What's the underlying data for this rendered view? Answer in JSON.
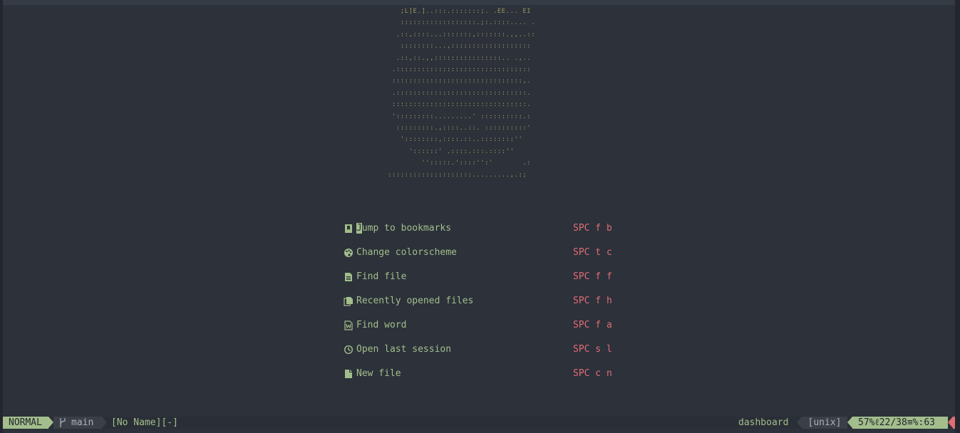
{
  "header_art": [
    "   ;L]E.]..:::.:::::::;. .EE... EI",
    "   ::::::::::::::::::.;:.::::.... .",
    "  .::,::::...:::::::,:::::::.,,..::",
    "   ::::::::...,:::::::::::::::::::",
    "  .::,::.,,::::::::::::::::.. .,..",
    " .::::::::::::::::::::::::::::::::",
    " :::::::::::::::::::::::::::::::,.",
    " .:::::::::::::::::::::::::::::::.",
    " ::::::::::::::::::::::::::::::::.",
    " ':::::::::.........' ::::::::::.:",
    "  :::::::::.,::::..::. ::::::::::'",
    "   '::::::::,::::.::..::::::::''",
    "     '::::::' .::::.:::.::::''",
    "        '':::::.'::::'':'       .:",
    "::::::::::::::::::::.........,.:;"
  ],
  "menu": [
    {
      "icon": "bookmark-icon",
      "label": "Jump to bookmarks",
      "key": "SPC f b"
    },
    {
      "icon": "palette-icon",
      "label": "Change colorscheme",
      "key": "SPC t c"
    },
    {
      "icon": "file-icon",
      "label": "Find file",
      "key": "SPC f f"
    },
    {
      "icon": "files-icon",
      "label": "Recently opened files",
      "key": "SPC f h"
    },
    {
      "icon": "word-icon",
      "label": "Find word",
      "key": "SPC f a"
    },
    {
      "icon": "history-icon",
      "label": "Open last session",
      "key": "SPC s l"
    },
    {
      "icon": "new-file-icon",
      "label": "New file",
      "key": "SPC c n"
    }
  ],
  "statusline": {
    "mode": "NORMAL",
    "branch": "main",
    "filename": "[No Name][-]",
    "filetype": "dashboard",
    "fileformat": "[unix]",
    "position": "57%ℓ22/38≡%:63"
  },
  "colors": {
    "background": "#2c313a",
    "accent_green": "#a3be8c",
    "key_red": "#e06c75",
    "art_yellow": "#9a9360"
  }
}
